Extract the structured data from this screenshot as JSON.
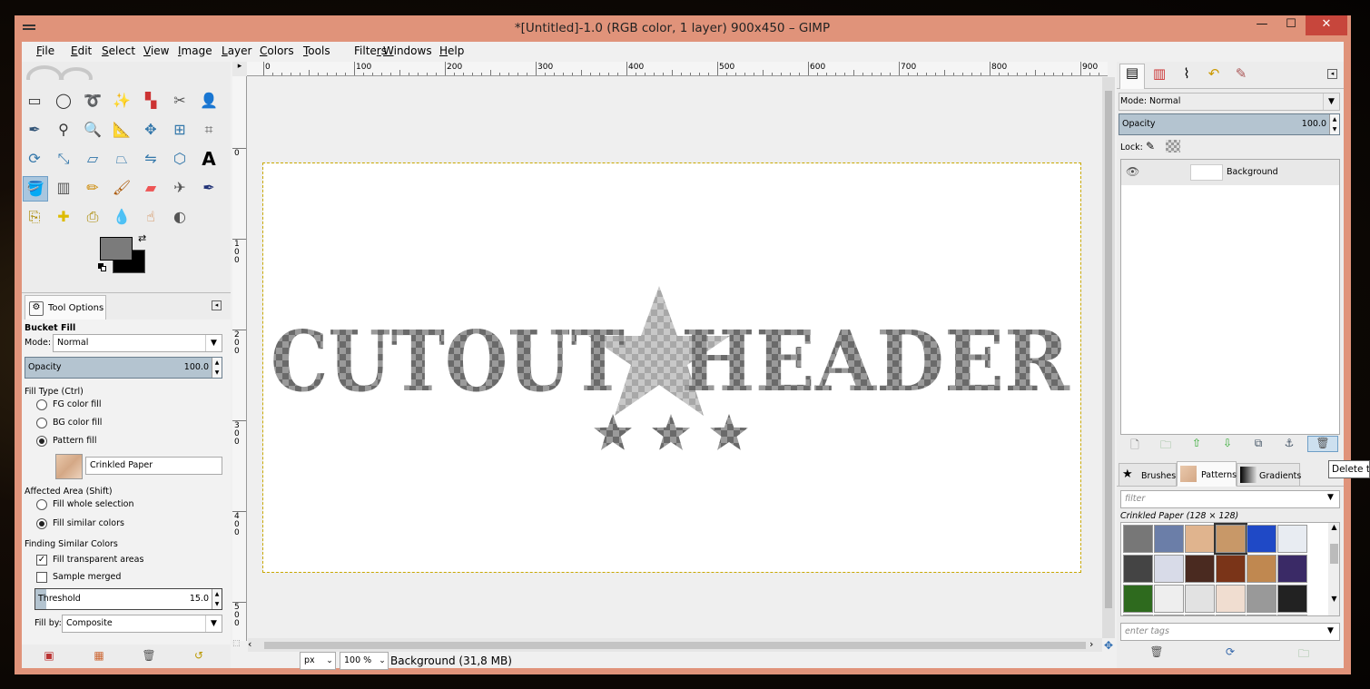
{
  "window": {
    "title": "*[Untitled]-1.0 (RGB color, 1 layer) 900x450 – GIMP",
    "minimize": "—",
    "maximize": "☐",
    "close": "✕"
  },
  "menubar": [
    "File",
    "Edit",
    "Select",
    "View",
    "Image",
    "Layer",
    "Colors",
    "Tools",
    "Filters",
    "Windows",
    "Help"
  ],
  "menu_accel": [
    "F",
    "E",
    "S",
    "V",
    "I",
    "L",
    "C",
    "T",
    "r",
    "W",
    "H"
  ],
  "tools": [
    "rect-select",
    "ellipse-select",
    "free-select",
    "fuzzy-select",
    "by-color-select",
    "scissors-select",
    "foreground-select",
    "paths",
    "color-picker",
    "zoom",
    "measure",
    "move",
    "align",
    "crop",
    "rotate",
    "scale",
    "shear",
    "perspective",
    "flip",
    "cage-transform",
    "text",
    "bucket-fill",
    "blend",
    "pencil",
    "paintbrush",
    "eraser",
    "airbrush",
    "ink",
    "clone",
    "heal",
    "perspective-clone",
    "blur",
    "smudge",
    "dodge-burn"
  ],
  "tool_options": {
    "tab_label": "Tool Options",
    "tool_name": "Bucket Fill",
    "mode_label": "Mode:",
    "mode_value": "Normal",
    "opacity_label": "Opacity",
    "opacity_value": "100.0",
    "fill_type_label": "Fill Type  (Ctrl)",
    "fill_options": [
      "FG color fill",
      "BG color fill",
      "Pattern fill"
    ],
    "fill_selected": 2,
    "pattern_name": "Crinkled Paper",
    "affected_label": "Affected Area  (Shift)",
    "affected_options": [
      "Fill whole selection",
      "Fill similar colors"
    ],
    "affected_selected": 1,
    "finding_label": "Finding Similar Colors",
    "chk_transparent": "Fill transparent areas",
    "chk_transparent_on": true,
    "chk_merged": "Sample merged",
    "chk_merged_on": false,
    "threshold_label": "Threshold",
    "threshold_value": "15.0",
    "threshold_fraction": 0.06,
    "fillby_label": "Fill by:",
    "fillby_value": "Composite"
  },
  "colors": {
    "fg": "#7b7b7b",
    "bg": "#000000",
    "accent": "#b4c4d0",
    "title_bar": "#e0937a"
  },
  "ruler": {
    "h_labels": [
      "0",
      "100",
      "200",
      "300",
      "400",
      "500",
      "600",
      "700",
      "800",
      "900"
    ],
    "v_labels": [
      "0",
      "1 0 0",
      "2 0 0",
      "3 0 0",
      "4 0 0",
      "5 0 0"
    ]
  },
  "canvas": {
    "text_left": "CUTOUT",
    "text_right": "HEADER",
    "star_count": 3
  },
  "statusbar": {
    "unit": "px",
    "zoom": "100 %",
    "info": "Background (31,8 MB)"
  },
  "layers": {
    "mode_label": "Mode:",
    "mode_value": "Normal",
    "opacity_label": "Opacity",
    "opacity_value": "100.0",
    "lock_label": "Lock:",
    "items": [
      {
        "name": "Background",
        "visible": true
      }
    ]
  },
  "resources": {
    "tabs": [
      "Brushes",
      "Patterns",
      "Gradients"
    ],
    "active_tab": 1,
    "filter_placeholder": "filter",
    "selected_label": "Crinkled Paper (128 × 128)",
    "tags_placeholder": "enter tags"
  },
  "tooltip": "Delete this layer"
}
